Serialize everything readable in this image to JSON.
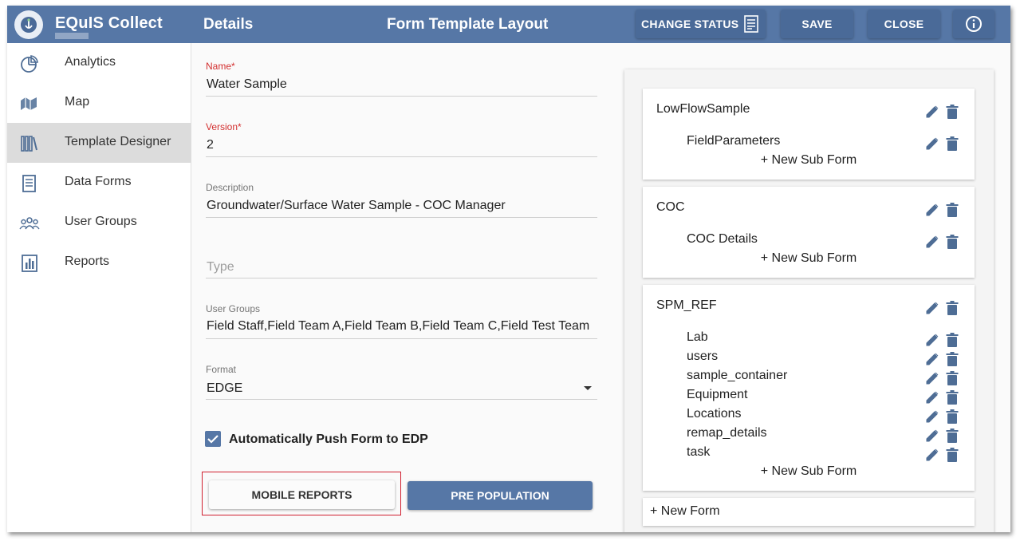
{
  "header": {
    "app_name": "EQuIS Collect",
    "details_title": "Details",
    "layout_title": "Form Template Layout",
    "change_status_label": "CHANGE STATUS",
    "save_label": "SAVE",
    "close_label": "CLOSE"
  },
  "sidebar": {
    "items": [
      {
        "label": "Analytics",
        "icon": "pie-chart-icon"
      },
      {
        "label": "Map",
        "icon": "map-icon"
      },
      {
        "label": "Template Designer",
        "icon": "books-icon",
        "active": true
      },
      {
        "label": "Data Forms",
        "icon": "document-icon"
      },
      {
        "label": "User Groups",
        "icon": "people-icon"
      },
      {
        "label": "Reports",
        "icon": "bar-chart-icon"
      }
    ]
  },
  "form": {
    "name": {
      "label": "Name",
      "required_mark": "*",
      "value": "Water Sample"
    },
    "version": {
      "label": "Version",
      "required_mark": "*",
      "value": "2"
    },
    "description": {
      "label": "Description",
      "value": "Groundwater/Surface Water Sample - COC Manager"
    },
    "type": {
      "placeholder": "Type",
      "value": ""
    },
    "user_groups": {
      "label": "User Groups",
      "value": "Field Staff,Field Team A,Field Team B,Field Team C,Field Test Team"
    },
    "format": {
      "label": "Format",
      "value": "EDGE"
    },
    "auto_push": {
      "label": "Automatically Push Form to EDP",
      "checked": true
    },
    "mobile_reports_label": "MOBILE REPORTS",
    "pre_population_label": "PRE POPULATION"
  },
  "layout": {
    "forms": [
      {
        "name": "LowFlowSample",
        "subforms": [
          "FieldParameters"
        ],
        "new_sub_label": "+ New Sub Form"
      },
      {
        "name": "COC",
        "subforms": [
          "COC Details"
        ],
        "new_sub_label": "+ New Sub Form"
      },
      {
        "name": "SPM_REF",
        "subforms": [
          "Lab",
          "users",
          "sample_container",
          "Equipment",
          "Locations",
          "remap_details",
          "task"
        ],
        "new_sub_label": "+ New Sub Form"
      }
    ],
    "new_form_label": "+ New Form"
  },
  "colors": {
    "header": "#5677a6",
    "button": "#4a6a98",
    "required": "#d32f2f",
    "highlight": "#d01f2f",
    "icon": "#4e6d95"
  }
}
